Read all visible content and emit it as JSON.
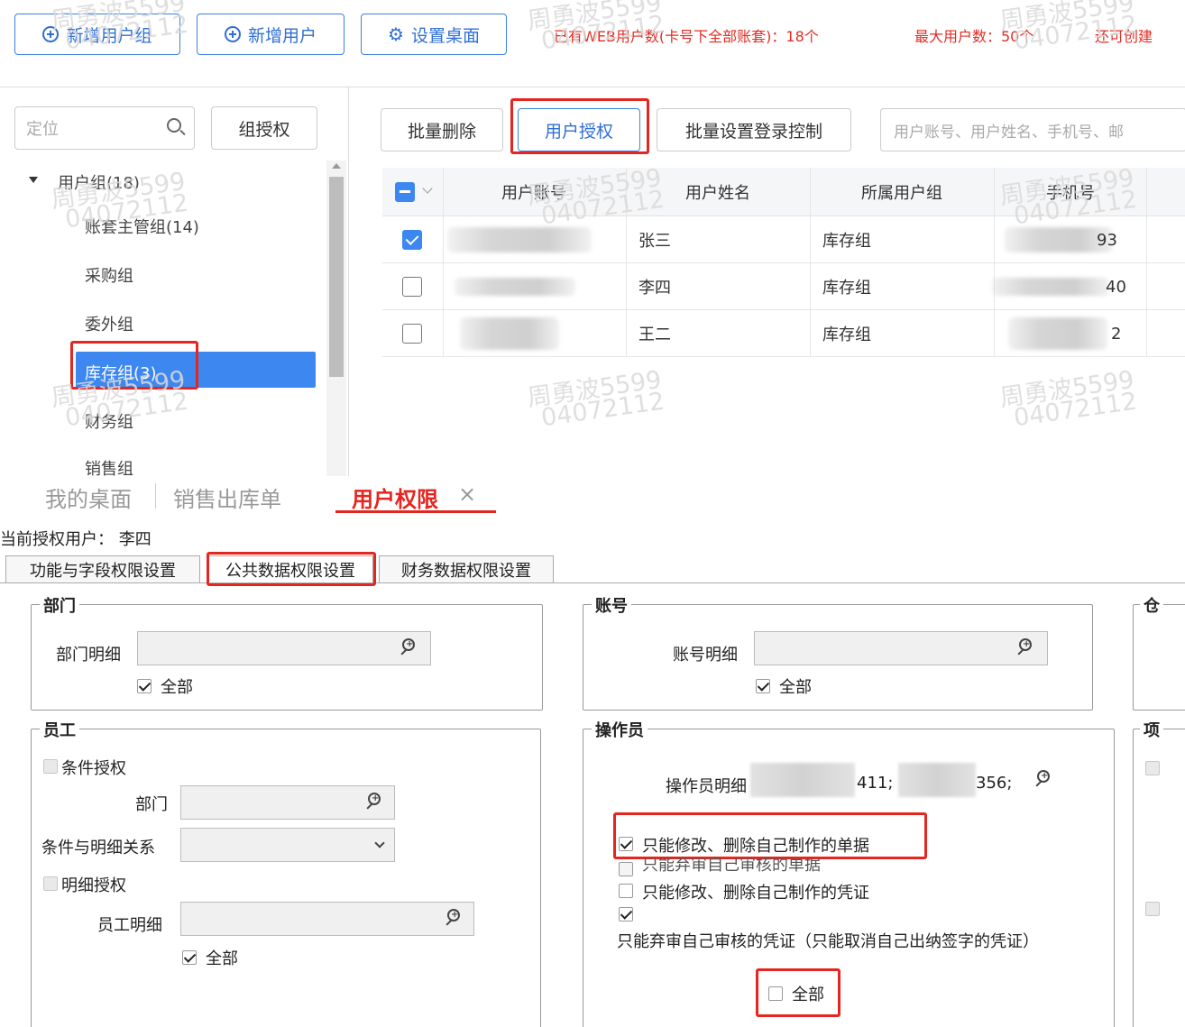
{
  "toolbar": {
    "add_group": "新增用户组",
    "add_user": "新增用户",
    "set_desktop": "设置桌面",
    "stats": "已有WEB用户数(卡号下全部账套)：18个",
    "max_users": "最大用户数：50个",
    "remaining": "还可创建"
  },
  "left_panel": {
    "search_placeholder": "定位",
    "group_auth": "组授权",
    "tree": [
      {
        "label": "用户组(18)"
      },
      {
        "label": "账套主管组(14)"
      },
      {
        "label": "采购组"
      },
      {
        "label": "委外组"
      },
      {
        "label": "库存组(3)"
      },
      {
        "label": "财务组"
      },
      {
        "label": "销售组"
      }
    ]
  },
  "right_panel": {
    "batch_delete": "批量删除",
    "user_auth": "用户授权",
    "batch_login": "批量设置登录控制",
    "filter_placeholder": "用户账号、用户姓名、手机号、邮",
    "columns": [
      "用户账号",
      "用户姓名",
      "所属用户组",
      "手机号"
    ],
    "rows": [
      {
        "name": "张三",
        "group": "库存组",
        "phone_tail": "93",
        "checked": true
      },
      {
        "name": "李四",
        "group": "库存组",
        "phone_tail": "40",
        "checked": false
      },
      {
        "name": "王二",
        "group": "库存组",
        "phone_tail": "2",
        "checked": false
      }
    ]
  },
  "watermark": {
    "line1": "周勇波5599",
    "line2": "04072112"
  },
  "tabs": [
    {
      "label": "我的桌面"
    },
    {
      "label": "销售出库单"
    },
    {
      "label": "用户权限",
      "close": "×"
    }
  ],
  "current_user": {
    "label": "当前授权用户：",
    "name": "李四"
  },
  "subtabs": [
    "功能与字段权限设置",
    "公共数据权限设置",
    "财务数据权限设置"
  ],
  "dept_group": {
    "title": "部门",
    "detail_label": "部门明细",
    "all": "全部"
  },
  "account_group": {
    "title": "账号",
    "detail_label": "账号明细",
    "all": "全部"
  },
  "employee_group": {
    "title": "员工",
    "cond_auth": "条件授权",
    "dept": "部门",
    "relation": "条件与明细关系",
    "detail_auth": "明细授权",
    "emp_detail": "员工明细",
    "all": "全部"
  },
  "operator_group": {
    "title": "操作员",
    "detail_label": "操作员明细",
    "value_part1": "411;",
    "value_part2": "356;",
    "opt1": "只能修改、删除自己制作的单据",
    "opt2": "只能弃审自己审核的单据",
    "opt3": "只能修改、删除自己制作的凭证",
    "opt4": "只能弃审自己审核的凭证（只能取消自己出纳签字的凭证）",
    "all": "全部"
  },
  "edge_groups": {
    "warehouse": "仓",
    "project": "项"
  }
}
